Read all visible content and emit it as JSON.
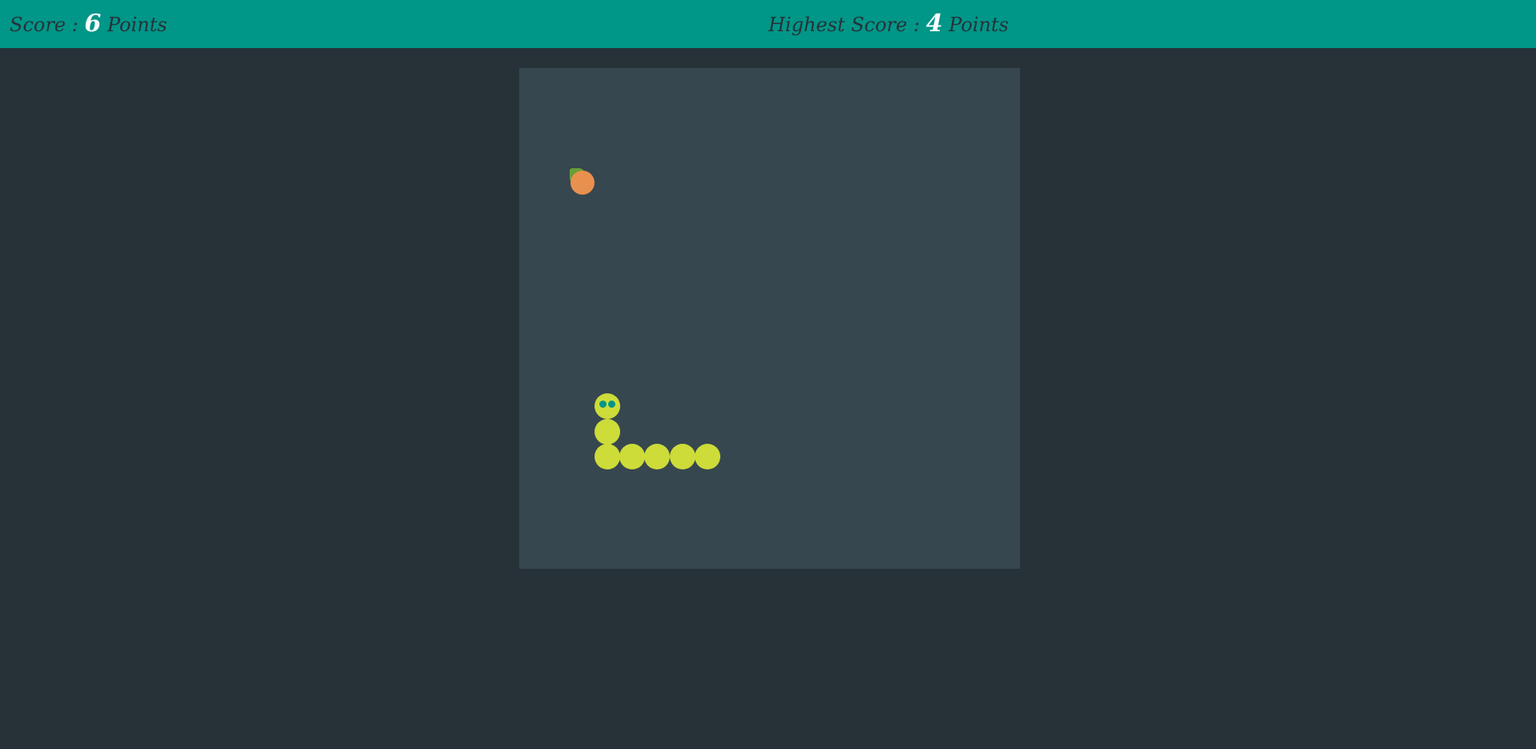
{
  "header": {
    "score_label": "Score : ",
    "score_value": "6",
    "score_unit": " Points",
    "high_label": "Highest Score : ",
    "high_value": "4",
    "high_unit": " Points"
  },
  "game": {
    "grid_columns": 20,
    "grid_rows": 20,
    "snake": [
      {
        "col": 3,
        "row": 13
      },
      {
        "col": 3,
        "row": 14
      },
      {
        "col": 3,
        "row": 15
      },
      {
        "col": 4,
        "row": 15
      },
      {
        "col": 5,
        "row": 15
      },
      {
        "col": 6,
        "row": 15
      },
      {
        "col": 7,
        "row": 15
      }
    ],
    "food": {
      "col": 2,
      "row": 4
    }
  },
  "colors": {
    "header_bg": "#009688",
    "page_bg": "#263238",
    "board_bg": "#37474f",
    "snake": "#cddc39",
    "eye": "#009688",
    "food": "#e8914f",
    "leaf": "#689f38"
  },
  "icons": {
    "food": "orange-fruit-icon",
    "snake_head": "snake-head-icon"
  }
}
